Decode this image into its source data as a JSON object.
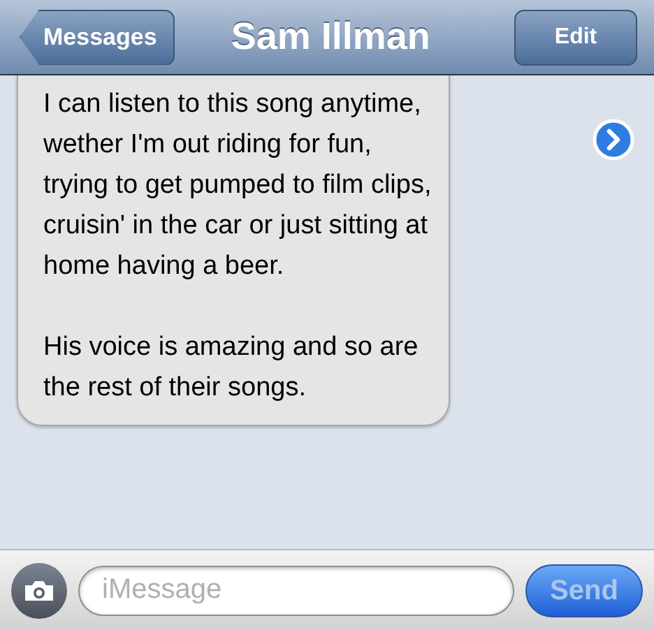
{
  "nav_bar": {
    "back_button": "Messages",
    "title": "Sam Illman",
    "edit_button": "Edit"
  },
  "messages": [
    {
      "kind": "received",
      "paragraphs": [
        "I can listen to this song anytime, wether I'm out riding for fun, trying to get pumped to film clips, cruisin' in the car or just sitting at home having a beer.",
        "His voice is amazing and so are the rest of their songs."
      ]
    }
  ],
  "input_bar": {
    "placeholder": "iMessage",
    "send_button": {
      "label": "Send",
      "disabled": true
    }
  }
}
